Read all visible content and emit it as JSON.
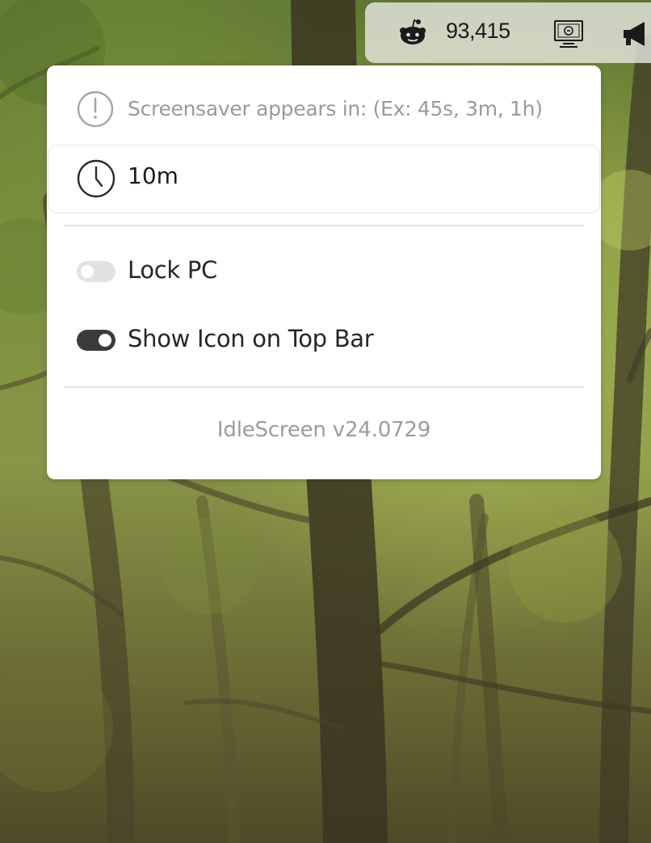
{
  "topbar": {
    "reddit_icon": "reddit-icon",
    "reddit_count": "93,415",
    "screen_icon": "monitor-icon",
    "megaphone_icon": "megaphone-icon"
  },
  "popup": {
    "hint_icon": "exclamation-circle-icon",
    "hint_text": "Screensaver appears in: (Ex: 45s, 3m, 1h)",
    "timeout_icon": "clock-icon",
    "timeout_value": "10m",
    "toggles": [
      {
        "label": "Lock PC",
        "enabled": false
      },
      {
        "label": "Show Icon on Top Bar",
        "enabled": true
      }
    ],
    "version": "IdleScreen v24.0729"
  },
  "colors": {
    "popup_bg": "#ffffff",
    "toggle_on": "#3b3b3b",
    "toggle_off": "#e2e2e2",
    "muted_text": "#9a9a9a"
  }
}
